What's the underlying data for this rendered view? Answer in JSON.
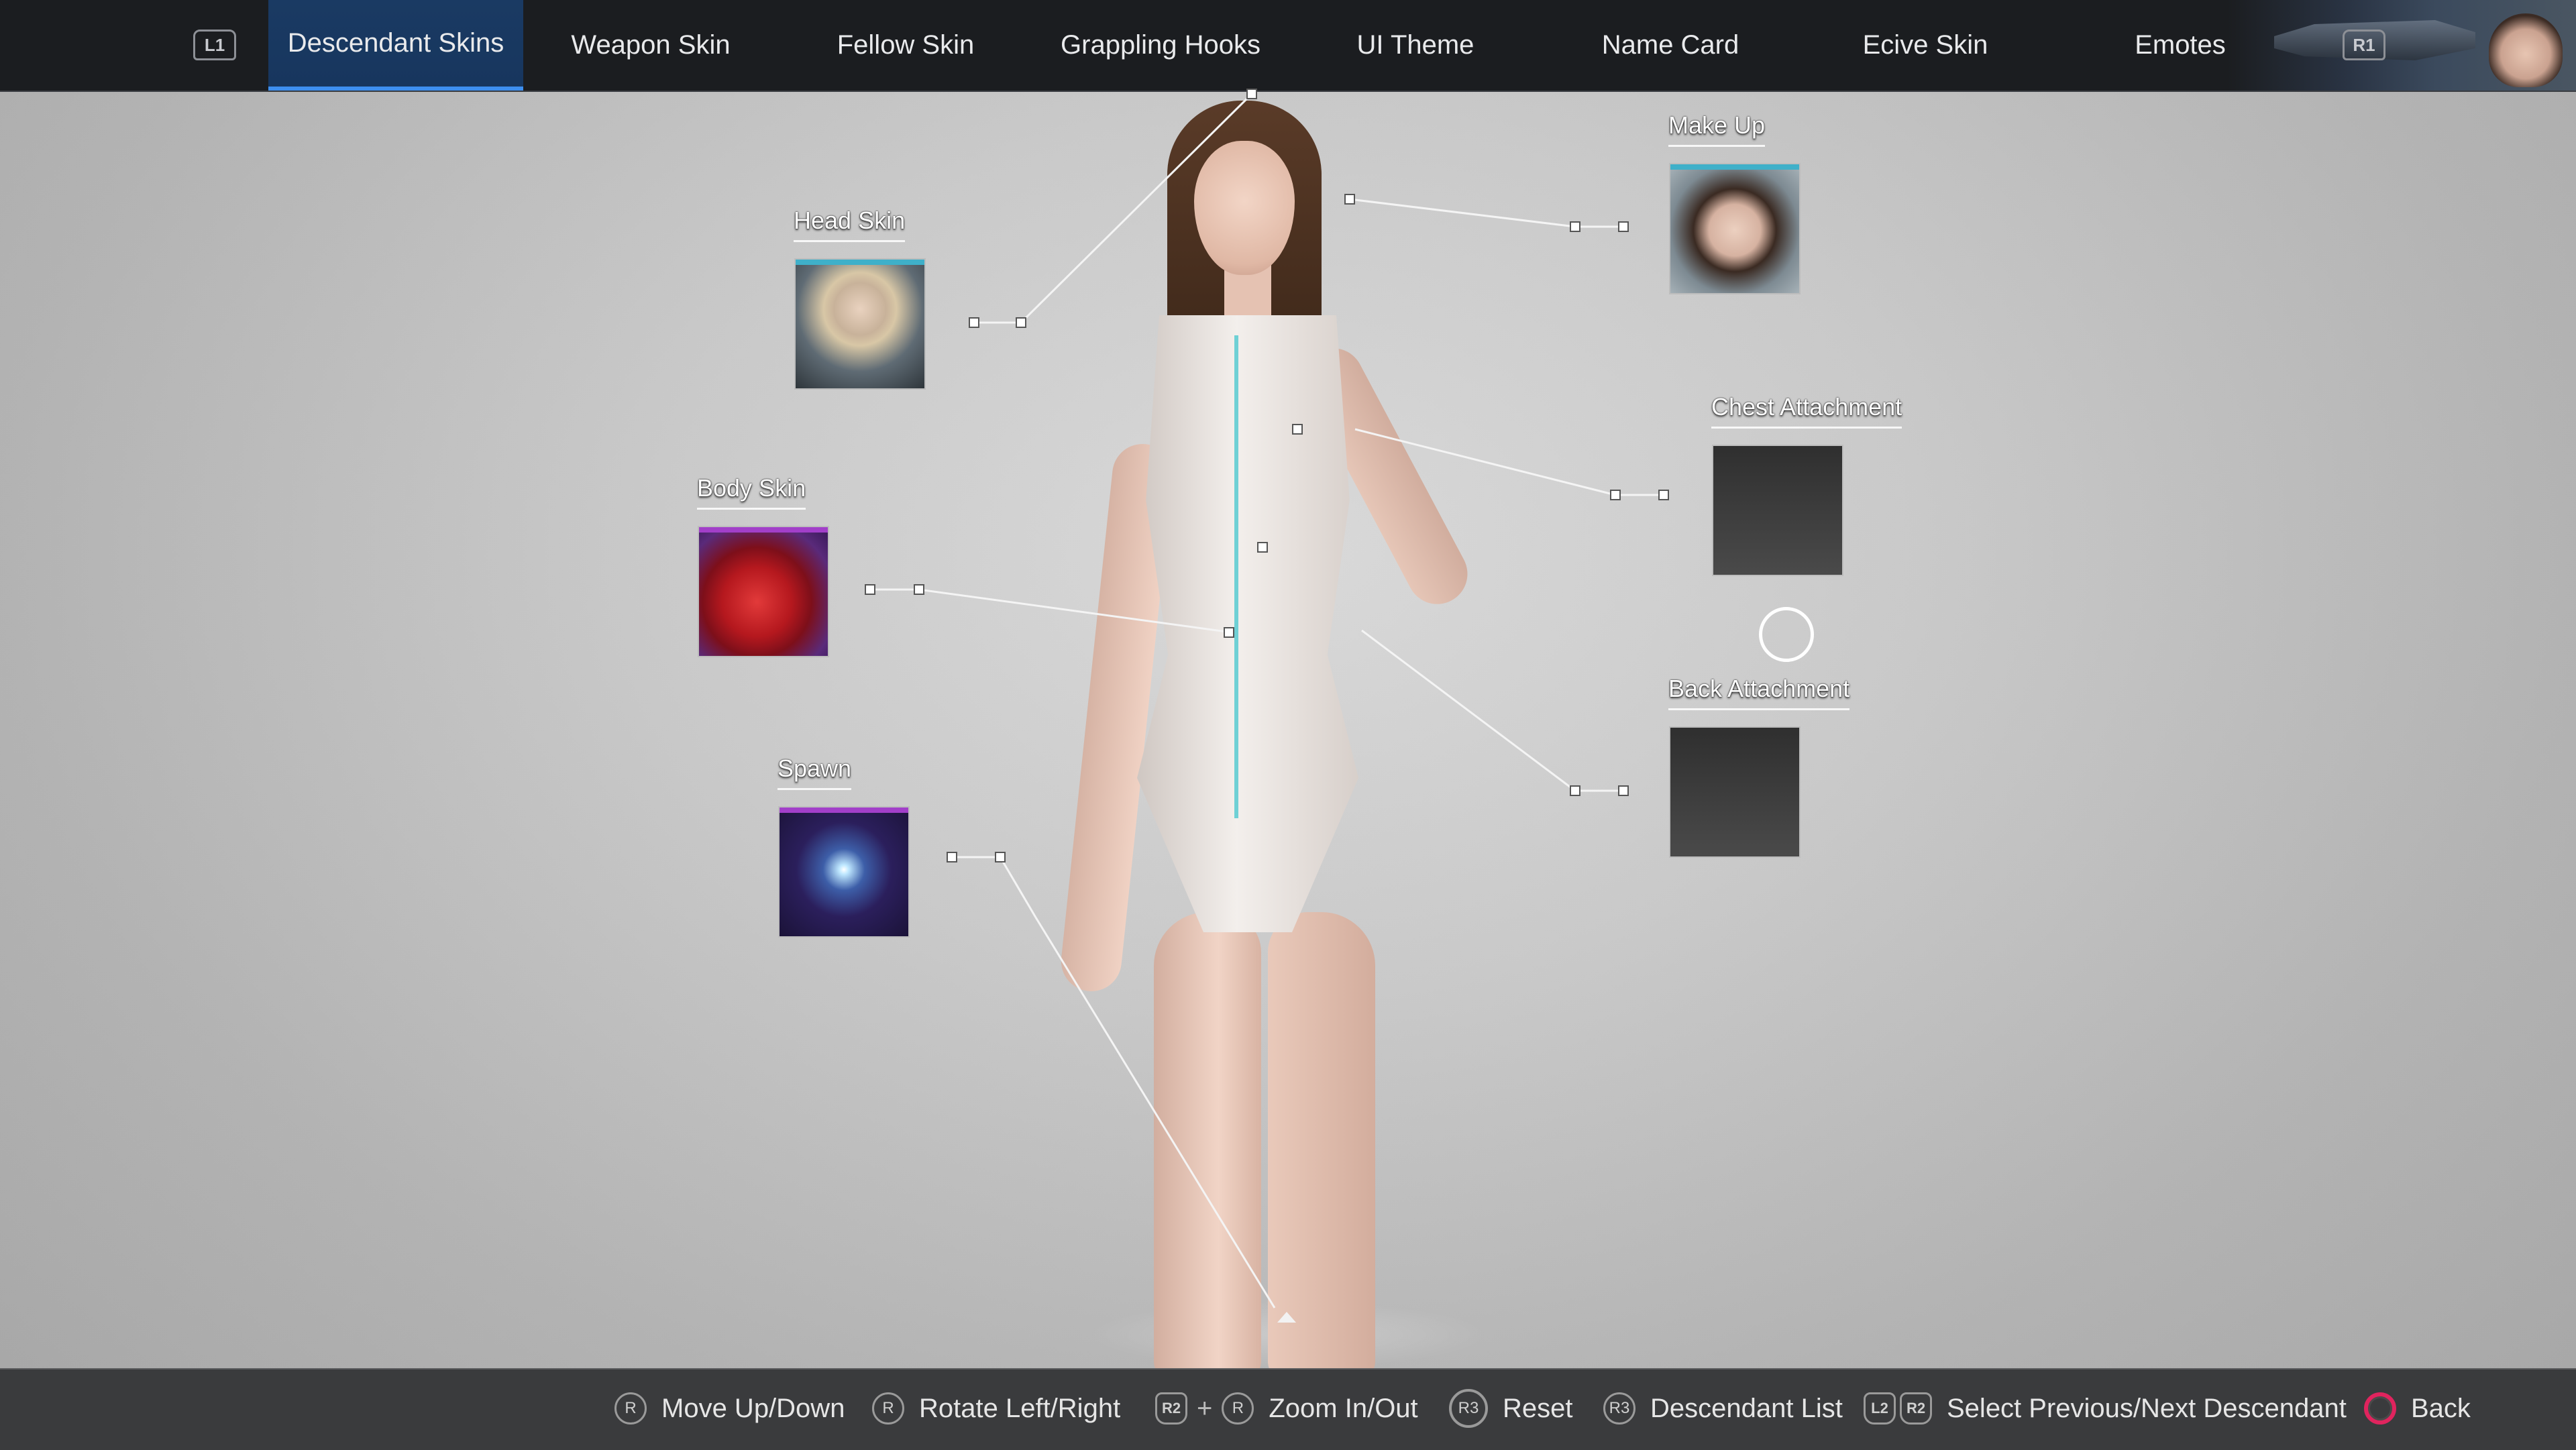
{
  "nav": {
    "left_button": "L1",
    "right_button": "R1",
    "tabs": [
      {
        "label": "Descendant Skins"
      },
      {
        "label": "Weapon Skin"
      },
      {
        "label": "Fellow Skin"
      },
      {
        "label": "Grappling Hooks"
      },
      {
        "label": "UI Theme"
      },
      {
        "label": "Name Card"
      },
      {
        "label": "Ecive Skin"
      },
      {
        "label": "Emotes"
      }
    ],
    "active_tab": "Descendant Skins"
  },
  "slots": {
    "head_skin": {
      "label": "Head Skin",
      "accent": "#3fb0c9"
    },
    "body_skin": {
      "label": "Body Skin",
      "accent": "#a23fc9"
    },
    "spawn": {
      "label": "Spawn",
      "accent": "#a23fc9"
    },
    "make_up": {
      "label": "Make Up",
      "accent": "#3fb0c9"
    },
    "chest_attachment": {
      "label": "Chest Attachment"
    },
    "back_attachment": {
      "label": "Back Attachment"
    }
  },
  "controls": {
    "move": {
      "icon": "R",
      "label": "Move Up/Down"
    },
    "rotate": {
      "icon": "R",
      "label": "Rotate Left/Right"
    },
    "zoom": {
      "icon1": "R2",
      "plus": "+",
      "icon2": "R",
      "label": "Zoom In/Out"
    },
    "reset": {
      "icon": "R3",
      "label": "Reset"
    },
    "descendant_list": {
      "icon": "R3",
      "label": "Descendant List"
    },
    "select": {
      "icon1": "L2",
      "icon2": "R2",
      "label": "Select Previous/Next Descendant"
    },
    "back": {
      "label": "Back"
    }
  }
}
